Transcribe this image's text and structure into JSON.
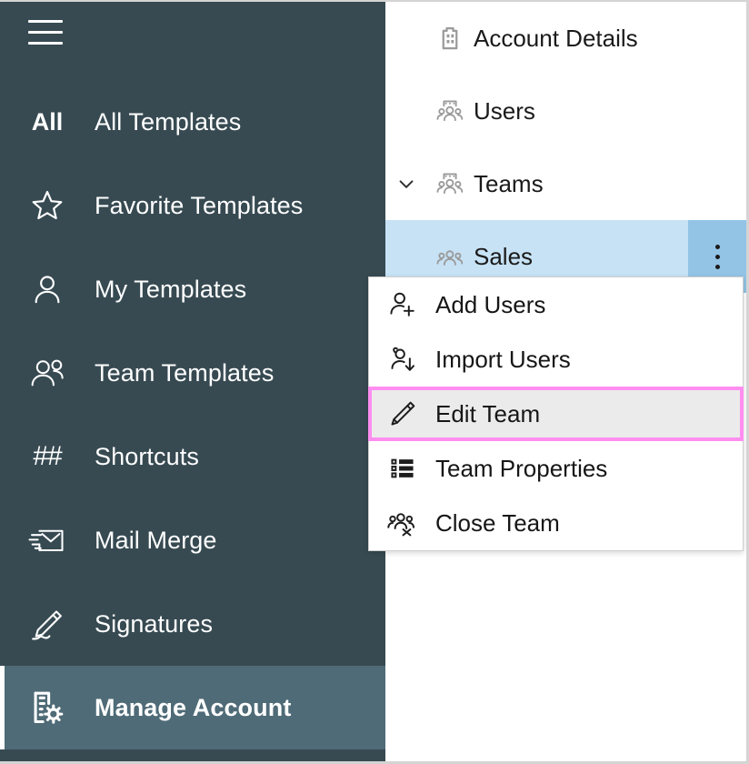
{
  "sidebar": {
    "menu_button": "menu",
    "accent_selected_bg": "#4f6b77",
    "background": "#374a52",
    "items": [
      {
        "label": "All Templates",
        "icon": "all-text-icon",
        "selected": false
      },
      {
        "label": "Favorite Templates",
        "icon": "star-icon",
        "selected": false
      },
      {
        "label": "My Templates",
        "icon": "person-icon",
        "selected": false
      },
      {
        "label": "Team Templates",
        "icon": "people-icon",
        "selected": false
      },
      {
        "label": "Shortcuts",
        "icon": "hash-icon",
        "selected": false
      },
      {
        "label": "Mail Merge",
        "icon": "mail-merge-icon",
        "selected": false
      },
      {
        "label": "Signatures",
        "icon": "signature-pen-icon",
        "selected": false
      },
      {
        "label": "Manage Account",
        "icon": "building-gear-icon",
        "selected": true
      }
    ],
    "all_glyph": "All",
    "hash_glyph": "##"
  },
  "tree": {
    "rows": [
      {
        "label": "Account Details",
        "icon": "building-icon",
        "indent": 0,
        "expandable": false,
        "selected": false
      },
      {
        "label": "Users",
        "icon": "users-icon",
        "indent": 0,
        "expandable": false,
        "selected": false
      },
      {
        "label": "Teams",
        "icon": "team-icon",
        "indent": 0,
        "expandable": true,
        "expanded": true,
        "selected": false
      },
      {
        "label": "Sales",
        "icon": "team-icon",
        "indent": 1,
        "expandable": false,
        "selected": true,
        "kebab": true
      }
    ],
    "selected_bg": "#c7e2f5",
    "kebab_bg": "#93c4e6"
  },
  "context_menu": {
    "items": [
      {
        "label": "Add Users",
        "icon": "person-add-icon",
        "highlighted": false
      },
      {
        "label": "Import Users",
        "icon": "person-import-icon",
        "highlighted": false
      },
      {
        "label": "Edit Team",
        "icon": "pencil-icon",
        "highlighted": true
      },
      {
        "label": "Team Properties",
        "icon": "list-details-icon",
        "highlighted": false
      },
      {
        "label": "Close Team",
        "icon": "team-close-icon",
        "highlighted": false
      }
    ],
    "highlight_border_color": "#ff8ef0",
    "highlight_row_bg": "#ebebeb"
  }
}
